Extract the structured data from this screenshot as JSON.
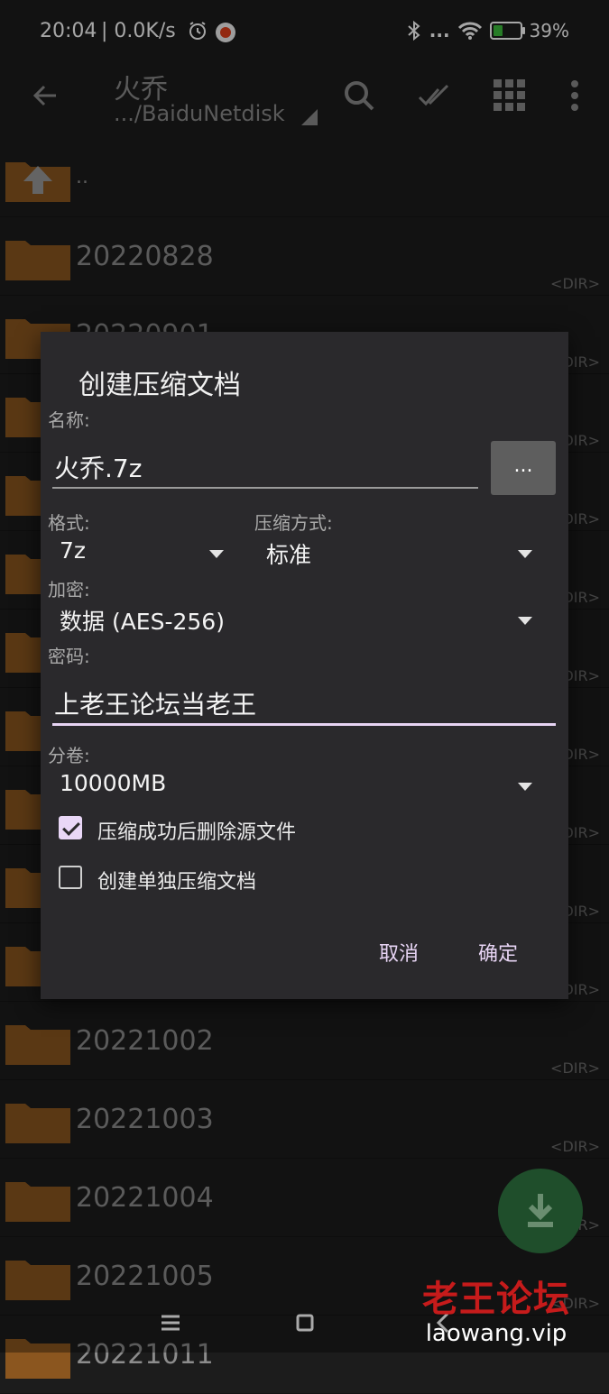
{
  "status_bar": {
    "time": "20:04",
    "network_speed": "| 0.0K/s",
    "battery_percent": "39%",
    "signal_dots": "..."
  },
  "app_bar": {
    "title": "火乔",
    "path": ".../BaiduNetdisk"
  },
  "file_list": {
    "parent": "..",
    "dir_tag": "<DIR>",
    "folders": [
      "20220828",
      "20220901",
      "20221002",
      "20221003",
      "20221004",
      "20221005",
      "20221011"
    ]
  },
  "dialog": {
    "title": "创建压缩文档",
    "name_label": "名称:",
    "name_value": "火乔.7z",
    "browse_label": "...",
    "format_label": "格式:",
    "format_value": "7z",
    "method_label": "压缩方式:",
    "method_value": "标准",
    "encryption_label": "加密:",
    "encryption_value": "数据 (AES-256)",
    "password_label": "密码:",
    "password_value": "上老王论坛当老王",
    "volume_label": "分卷:",
    "volume_value": "10000MB",
    "delete_source_label": "压缩成功后删除源文件",
    "delete_source_checked": true,
    "separate_archives_label": "创建单独压缩文档",
    "separate_archives_checked": false,
    "cancel_label": "取消",
    "ok_label": "确定"
  },
  "watermark": {
    "text_cn": "老王论坛",
    "text_url": "laowang.vip"
  },
  "colors": {
    "background": "#1c1c1c",
    "dialog": "#2a292c",
    "accent": "#e7d4f4",
    "folder": "#a0642a",
    "fab": "#1f4e2b",
    "watermark_red": "#c61b1b"
  }
}
